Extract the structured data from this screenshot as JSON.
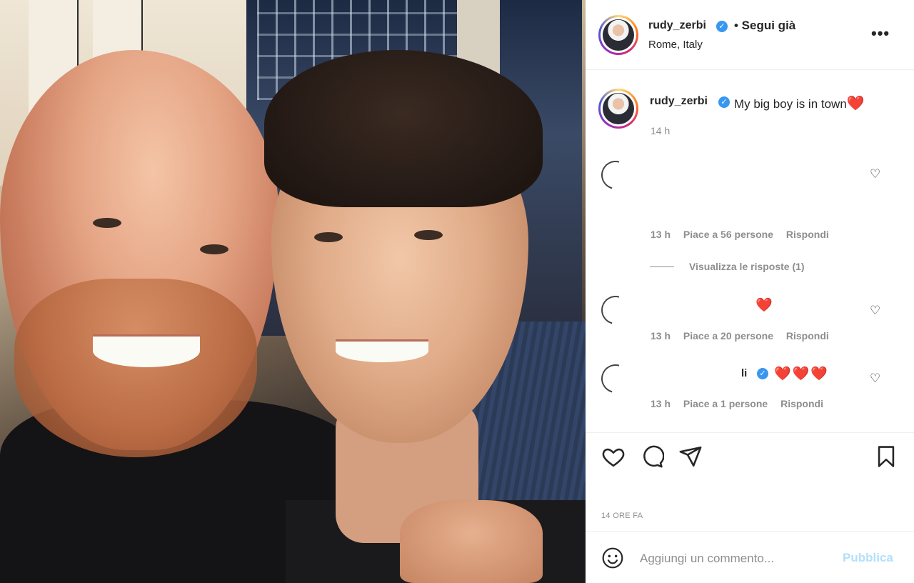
{
  "post": {
    "username": "rudy_zerbi",
    "follow_status": "• Segui già",
    "location": "Rome, Italy",
    "more_label": "•••"
  },
  "caption": {
    "username": "rudy_zerbi",
    "text": "My big boy is in town",
    "emoji": "❤️",
    "time": "14 h"
  },
  "comments": [
    {
      "time": "13 h",
      "likes": "Piace a 56 persone",
      "reply": "Rispondi",
      "view_replies": "Visualizza le risposte (1)"
    },
    {
      "hearts": "❤️",
      "time": "13 h",
      "likes": "Piace a 20 persone",
      "reply": "Rispondi"
    },
    {
      "name_partial": "li",
      "hearts": "❤️❤️❤️",
      "time": "13 h",
      "likes": "Piace a 1 persone",
      "reply": "Rispondi"
    }
  ],
  "actions": {
    "date": "14 ORE FA"
  },
  "add_comment": {
    "placeholder": "Aggiungi un commento...",
    "publish": "Pubblica"
  },
  "colors": {
    "verified": "#3897f0",
    "heart": "#ed1c3b",
    "publish_disabled": "#b2dffc",
    "muted": "#8e8e8e"
  },
  "icons": [
    "verified-badge-icon",
    "more-options-icon",
    "heart-icon",
    "comment-icon",
    "share-icon",
    "bookmark-icon",
    "emoji-icon",
    "loading-spinner-icon"
  ]
}
